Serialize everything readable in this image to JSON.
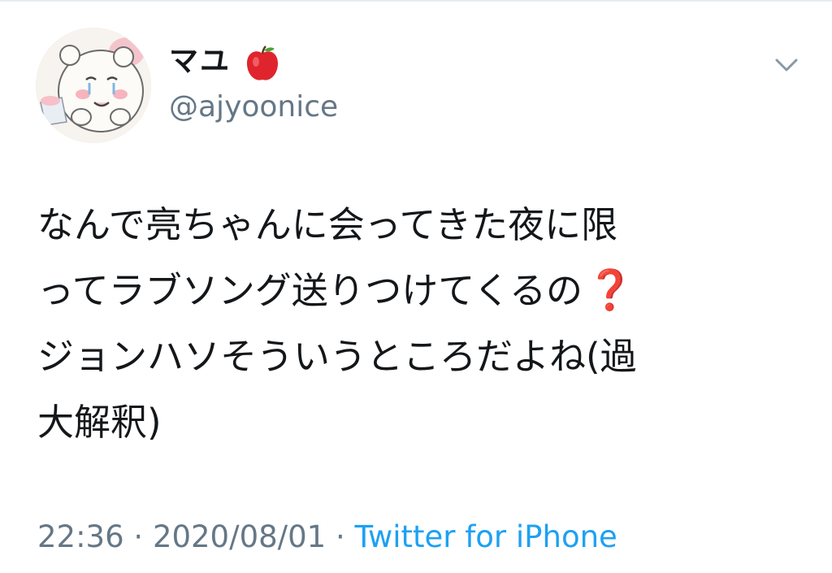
{
  "user": {
    "display_name": "マユ",
    "handle": "@ajyoonice"
  },
  "tweet": {
    "lines": [
      "なんで亮ちゃんに会ってきた夜に限",
      "ってラブソング送りつけてくるの",
      "ジョンハソそういうところだよね(過",
      "大解釈)"
    ],
    "emoji": "❓"
  },
  "meta": {
    "time": "22:36",
    "separator": "·",
    "date": "2020/08/01",
    "source": "Twitter for iPhone"
  },
  "colors": {
    "text": "#14171a",
    "secondary": "#657786",
    "link": "#1da1f2",
    "question_red": "#d42020"
  },
  "icons": {
    "name_emoji": "red-apple-icon",
    "menu": "chevron-down-icon",
    "tweet_emoji": "red-question-mark-icon"
  }
}
